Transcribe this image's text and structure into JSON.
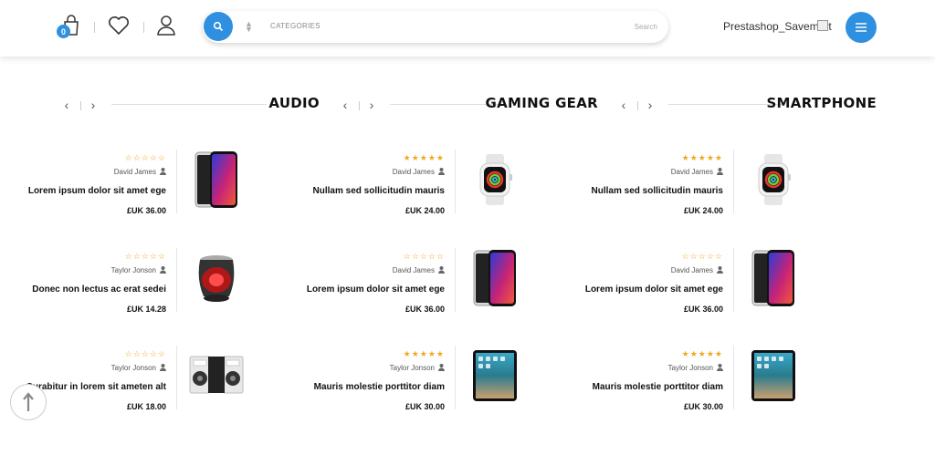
{
  "header": {
    "cart_count": "0",
    "search": {
      "category_label": "CATEGORIES",
      "placeholder": "Search"
    },
    "shop_name": "Prestashop_Savemart"
  },
  "columns": [
    {
      "title": "AUDIO",
      "products": [
        {
          "rating": 0,
          "author": "David James",
          "name": "Lorem ipsum dolor sit amet ege",
          "price": "£UK 36.00",
          "image": "smartphone-icon"
        },
        {
          "rating": 0,
          "author": "Taylor Jonson",
          "name": "Donec non lectus ac erat sedei",
          "price": "£UK 14.28",
          "image": "speaker-icon"
        },
        {
          "rating": 0,
          "author": "Taylor Jonson",
          "name": "Curabitur in lorem sit ameten alt",
          "price": "£UK 18.00",
          "image": "speakers-pair-icon"
        }
      ]
    },
    {
      "title": "GAMING GEAR",
      "products": [
        {
          "rating": 5,
          "author": "David James",
          "name": "Nullam sed sollicitudin mauris",
          "price": "£UK 24.00",
          "image": "smartwatch-icon"
        },
        {
          "rating": 0,
          "author": "David James",
          "name": "Lorem ipsum dolor sit amet ege",
          "price": "£UK 36.00",
          "image": "smartphone-icon"
        },
        {
          "rating": 5,
          "author": "Taylor Jonson",
          "name": "Mauris molestie porttitor diam",
          "price": "£UK 30.00",
          "image": "tablet-icon"
        }
      ]
    },
    {
      "title": "SMARTPHONE",
      "products": [
        {
          "rating": 5,
          "author": "David James",
          "name": "Nullam sed sollicitudin mauris",
          "price": "£UK 24.00",
          "image": "smartwatch-icon"
        },
        {
          "rating": 0,
          "author": "David James",
          "name": "Lorem ipsum dolor sit amet ege",
          "price": "£UK 36.00",
          "image": "smartphone-icon"
        },
        {
          "rating": 5,
          "author": "Taylor Jonson",
          "name": "Mauris molestie porttitor diam",
          "price": "£UK 30.00",
          "image": "tablet-icon"
        }
      ]
    }
  ],
  "colors": {
    "accent": "#2f8fe0",
    "star": "#f0a81c"
  }
}
